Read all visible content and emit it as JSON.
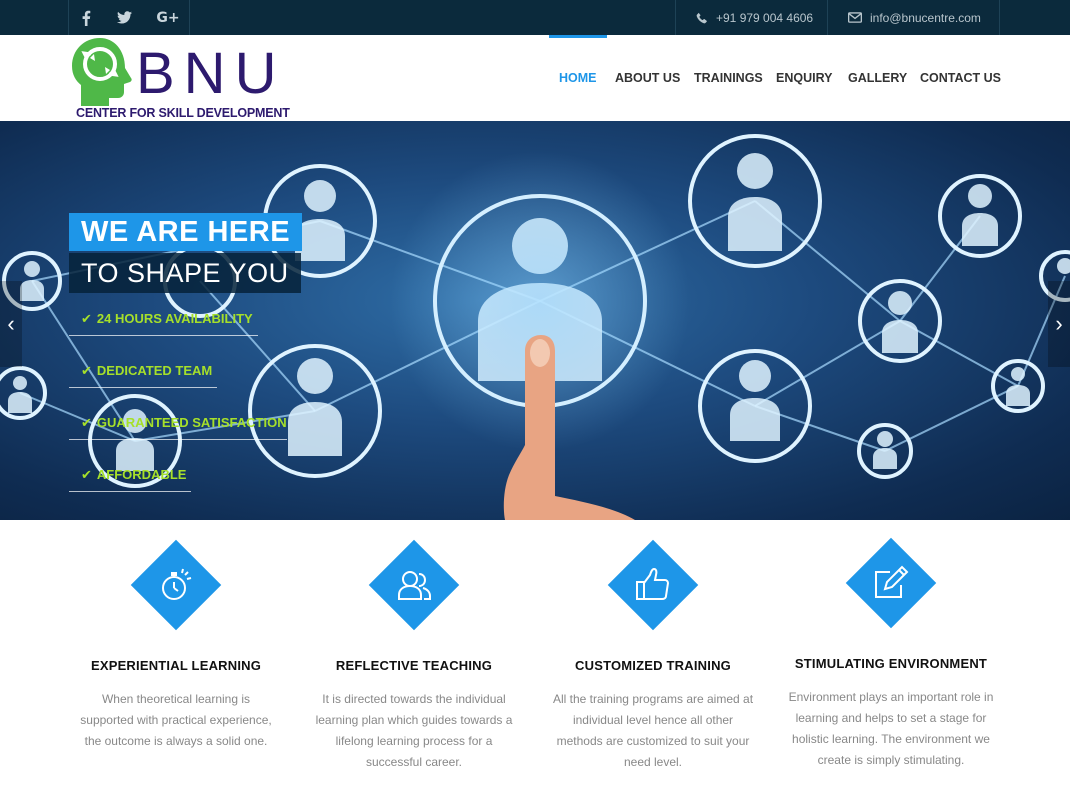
{
  "topbar": {
    "social": [
      {
        "icon": "facebook-icon",
        "glyph": "f"
      },
      {
        "icon": "twitter-icon",
        "glyph": "t"
      },
      {
        "icon": "google-plus-icon",
        "glyph": "G+"
      }
    ],
    "phone": "+91 979 004 4606",
    "email": "info@bnucentre.com"
  },
  "logo": {
    "name": "BNU",
    "subtitle": "CENTER FOR SKILL DEVELOPMENT"
  },
  "nav": {
    "items": [
      {
        "label": "HOME",
        "active": true
      },
      {
        "label": "ABOUT US"
      },
      {
        "label": "TRAININGS"
      },
      {
        "label": "ENQUIRY"
      },
      {
        "label": "GALLERY"
      },
      {
        "label": "CONTACT US"
      }
    ]
  },
  "hero": {
    "headline_1": "WE ARE HERE",
    "headline_2": "TO SHAPE YOU",
    "features": [
      "24 HOURS AVAILABILITY",
      "DEDICATED TEAM",
      "GUARANTEED SATISFACTION",
      "AFFORDABLE"
    ],
    "prev_arrow": "‹",
    "next_arrow": "›"
  },
  "cards": [
    {
      "icon": "stopwatch-icon",
      "title": "EXPERIENTIAL LEARNING",
      "lines": [
        "When theoretical learning is",
        "supported with practical experience,",
        "the outcome is always a solid one."
      ]
    },
    {
      "icon": "users-icon",
      "title": "REFLECTIVE TEACHING",
      "lines": [
        "It is directed towards the individual",
        "learning plan which guides towards a",
        "lifelong learning process for a",
        "successful career."
      ]
    },
    {
      "icon": "thumbs-up-icon",
      "title": "CUSTOMIZED TRAINING",
      "lines": [
        "All the training programs are aimed at",
        "individual level hence all other",
        "methods are customized to suit your",
        "need level."
      ]
    },
    {
      "icon": "edit-icon",
      "title": "STIMULATING ENVIRONMENT",
      "lines": [
        "Environment plays an important role in",
        "learning and helps to set a stage for",
        "holistic learning. The environment we",
        "create is simply stimulating."
      ]
    }
  ],
  "colors": {
    "accent": "#1e96e8",
    "topbar": "#0b2a3c",
    "feature_text": "#a6e02a",
    "logo": "#2d1a6e",
    "logo_head": "#4fb848"
  }
}
